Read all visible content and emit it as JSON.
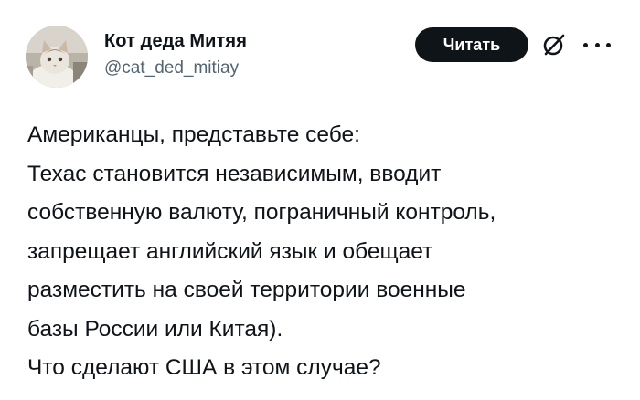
{
  "author": {
    "name": "Кот деда Митяя",
    "handle": "@cat_ded_mitiay"
  },
  "actions": {
    "follow_label": "Читать",
    "grok_icon": "grok-icon",
    "more_icon": "more-options-icon"
  },
  "post": {
    "lines": [
      "Американцы, представьте себе:",
      "Техас становится независимым, вводит",
      "собственную валюту, пограничный контроль,",
      "запрещает английский язык и обещает",
      "разместить на своей территории военные",
      "базы России или Китая).",
      "Что сделают США в этом случае?"
    ]
  }
}
